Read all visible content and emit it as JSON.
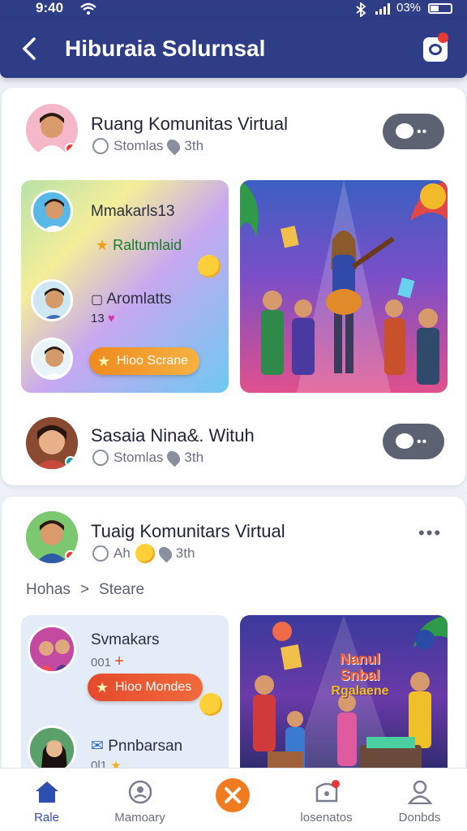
{
  "status_bar": {
    "time": "9:40",
    "battery_text": "03%"
  },
  "header": {
    "title": "Hiburaia Solurnsal"
  },
  "posts": [
    {
      "title": "Ruang Komunitas Virtual",
      "meta_text": "Stomlas",
      "meta_time": "3th",
      "panel": {
        "top_label": "Mmakarls13",
        "green_label": "Raltumlaid",
        "mid_label": "Aromlatts",
        "small_number": "13",
        "button_label": "Hioo Scrane"
      }
    },
    {
      "title": "Sasaia Nina&. Wituh",
      "meta_text": "Stomlas",
      "meta_time": "3th"
    },
    {
      "title": "Tuaig Komunitars Virtual",
      "meta_text": "Ah",
      "meta_time": "3th",
      "breadcrumb": [
        "Hohas",
        ">",
        "Steare"
      ],
      "panel": {
        "label_1": "Svmakars",
        "sub_1": "001",
        "button_label": "Hioo Mondes",
        "label_2": "Pnnbarsan",
        "sub_2": "0l1"
      },
      "poster_text": [
        "Nanul",
        "Snbal",
        "Rgalaene"
      ]
    }
  ],
  "tabs": [
    {
      "label": "Rale",
      "icon": "home-icon",
      "active": true
    },
    {
      "label": "Mamoary",
      "icon": "memory-icon",
      "active": false
    },
    {
      "label": "",
      "icon": "center-action-icon",
      "active": false
    },
    {
      "label": "losenatos",
      "icon": "notification-icon",
      "active": false
    },
    {
      "label": "Donbds",
      "icon": "profile-icon",
      "active": false
    }
  ],
  "colors": {
    "primary": "#2f3d86",
    "accent": "#f07c1f",
    "active_tab": "#2f4fb0"
  }
}
